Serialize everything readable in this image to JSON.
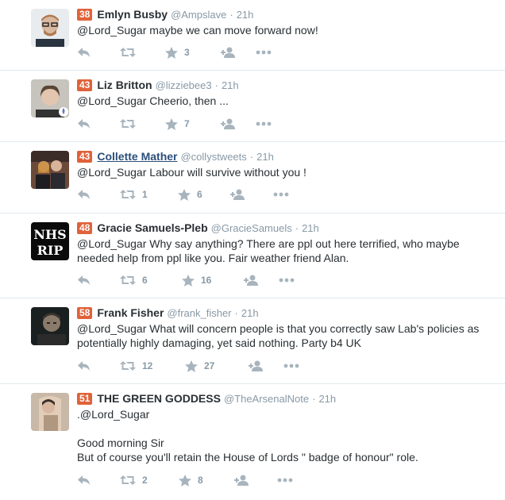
{
  "tweets": [
    {
      "score": "38",
      "name": "Emlyn Busby",
      "handle": "@Ampslave",
      "time": "21h",
      "mention": "@Lord_Sugar",
      "body": " maybe we can move forward now!",
      "extra_lines": [],
      "retweets": "",
      "favorites": "3"
    },
    {
      "score": "43",
      "name": "Liz Britton",
      "handle": "@lizziebee3",
      "time": "21h",
      "mention": "@Lord_Sugar",
      "body": " Cheerio, then ...",
      "extra_lines": [],
      "retweets": "",
      "favorites": "7"
    },
    {
      "score": "43",
      "name": "Collette Mather",
      "handle": "@collystweets",
      "time": "21h",
      "mention": "@Lord_Sugar",
      "body": " Labour will survive without you !",
      "extra_lines": [],
      "retweets": "1",
      "favorites": "6"
    },
    {
      "score": "48",
      "name": "Gracie Samuels-Pleb",
      "handle": "@GracieSamuels",
      "time": "21h",
      "mention": "@Lord_Sugar",
      "body": " Why say anything? There are ppl out here terrified, who maybe needed help from ppl like you. Fair weather friend  Alan.",
      "extra_lines": [],
      "retweets": "6",
      "favorites": "16",
      "avatar_text": [
        "NHS",
        "RIP"
      ]
    },
    {
      "score": "58",
      "name": "Frank Fisher",
      "handle": "@frank_fisher",
      "time": "21h",
      "mention": "@Lord_Sugar",
      "body": "  What will concern people is that you correctly saw Lab's policies as potentially highly damaging, yet said nothing. Party b4 UK",
      "extra_lines": [],
      "retweets": "12",
      "favorites": "27"
    },
    {
      "score": "51",
      "name": "THE GREEN GODDESS",
      "handle": "@TheArsenalNote",
      "time": "21h",
      "mention": ".@Lord_Sugar",
      "body": "",
      "extra_lines": [
        "",
        "Good morning Sir",
        "But of course you'll retain the  House of Lords \" badge of honour\" role."
      ],
      "retweets": "2",
      "favorites": "8"
    }
  ],
  "colors": {
    "badge": "#e0623a",
    "icon": "#a8b4bd",
    "meta": "#8899a6",
    "text": "#292f33"
  },
  "icons": [
    "reply-icon",
    "retweet-icon",
    "favorite-icon",
    "follow-icon",
    "more-icon"
  ]
}
